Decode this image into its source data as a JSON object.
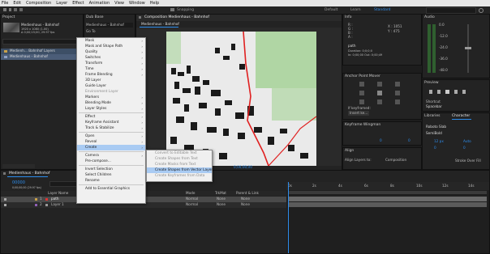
{
  "menubar": [
    "File",
    "Edit",
    "Composition",
    "Layer",
    "Effect",
    "Animation",
    "View",
    "Window",
    "Help"
  ],
  "toolbar": {
    "snapping": "Snapping",
    "workspaces": [
      "Default",
      "Learn",
      "Standard"
    ],
    "search": "Search Help"
  },
  "project": {
    "title": "Project",
    "item_name": "Medienhaus - Bahnhof",
    "item_line1": "1920 x 1080 (1.00)",
    "item_line2": "Δ 0;00;15;00, 29.97 fps",
    "folder1": "Medienh... Bahnhof Layers",
    "folder2": "Medienhaus - Bahnhof"
  },
  "dubbase": {
    "title": "Dub Base",
    "field": "Medienhaus - Bahnhof",
    "btn": "Go To"
  },
  "composition": {
    "title": "Composition Medienhaus - Bahnhof",
    "tab": "Medienhaus - Bahnhof",
    "zoom": "50%",
    "time": "0;00;00;00"
  },
  "context_menu": {
    "items": [
      {
        "label": "Mask",
        "arrow": true
      },
      {
        "label": "Mask and Shape Path",
        "arrow": true
      },
      {
        "label": "Quality",
        "arrow": true
      },
      {
        "label": "Switches",
        "arrow": true
      },
      {
        "label": "Transform",
        "arrow": true
      },
      {
        "label": "Time",
        "arrow": true
      },
      {
        "label": "Frame Blending",
        "arrow": true
      },
      {
        "label": "3D Layer"
      },
      {
        "label": "Guide Layer"
      },
      {
        "label": "Environment Layer",
        "disabled": true
      },
      {
        "label": "Markers",
        "arrow": true
      },
      {
        "label": "Blending Mode",
        "arrow": true
      },
      {
        "label": "Layer Styles",
        "arrow": true
      },
      {
        "sep": true
      },
      {
        "label": "Effect",
        "arrow": true
      },
      {
        "label": "Keyframe Assistant",
        "arrow": true
      },
      {
        "label": "Track & Stabilize",
        "arrow": true
      },
      {
        "sep": true
      },
      {
        "label": "Open",
        "arrow": true
      },
      {
        "label": "Reveal",
        "arrow": true
      },
      {
        "label": "Create",
        "arrow": true,
        "highlight": true
      },
      {
        "sep": true
      },
      {
        "label": "Camera",
        "arrow": true
      },
      {
        "label": "Pre-compose..."
      },
      {
        "sep": true
      },
      {
        "label": "Invert Selection"
      },
      {
        "label": "Select Children"
      },
      {
        "label": "Rename"
      },
      {
        "sep": true
      },
      {
        "label": "Add to Essential Graphics"
      }
    ]
  },
  "submenu": {
    "items": [
      {
        "label": "Convert to Editable Text",
        "disabled": true
      },
      {
        "label": "Create Shapes from Text",
        "disabled": true
      },
      {
        "label": "Create Masks from Text",
        "disabled": true
      },
      {
        "label": "Create Shapes from Vector Layer",
        "highlight": true
      },
      {
        "label": "Create Keyframes from Data",
        "disabled": true
      }
    ]
  },
  "info": {
    "title": "Info",
    "r": "R :",
    "g": "G :",
    "b": "B :",
    "a": "A :",
    "x": "X : 1051",
    "y": "Y : 475",
    "layer": "path",
    "dur_label": "Duration: 0;0;0;0",
    "in_out": "In: 0;00;00  Out: 0;00;49"
  },
  "anchor": {
    "title": "Anchor Point Mover"
  },
  "keyframe": {
    "title": "If keyframed:",
    "btn": "Insert ke..."
  },
  "wingman": {
    "title": "Keyframe Wingman",
    "fields": [
      "0",
      "0"
    ]
  },
  "align": {
    "title": "Align",
    "label": "Align Layers to:",
    "target": "Composition"
  },
  "audio": {
    "title": "Audio",
    "db_labels": [
      "0.0",
      "-12.0",
      "-24.0",
      "-36.0",
      "-48.0"
    ]
  },
  "preview": {
    "title": "Preview",
    "shortcut": "Shortcut",
    "shortcut_val": "Spacebar"
  },
  "libraries": {
    "title": "Libraries"
  },
  "character": {
    "title": "Character",
    "font": "Roboto Slab",
    "style": "SemiBold",
    "size": "12 px",
    "lead": "Auto",
    "kern": "0",
    "track": "0",
    "stroke": "Stroke Over Fill"
  },
  "paragraph": {
    "title": "Paragraph",
    "fields": [
      "0 px",
      "0 px",
      "0 px",
      "0 px",
      "0 px"
    ]
  },
  "timeline": {
    "title": "Medienhaus - Bahnhof",
    "timecode": "00000",
    "fps_label": "0;00;00;00 (29.97 fps)",
    "col_layer": "Layer Name",
    "col_mode": "Mode",
    "col_trk": "TrkMat",
    "col_parent": "Parent & Link",
    "layers": [
      {
        "num": "1",
        "name": "path",
        "mode": "Normal",
        "trk": "None",
        "parent": "None"
      },
      {
        "num": "2",
        "name": "Layer 1",
        "mode": "Normal",
        "trk": "None",
        "parent": "None"
      }
    ],
    "ruler": [
      "0s",
      "2s",
      "4s",
      "6s",
      "8s",
      "10s",
      "12s",
      "14s"
    ]
  }
}
